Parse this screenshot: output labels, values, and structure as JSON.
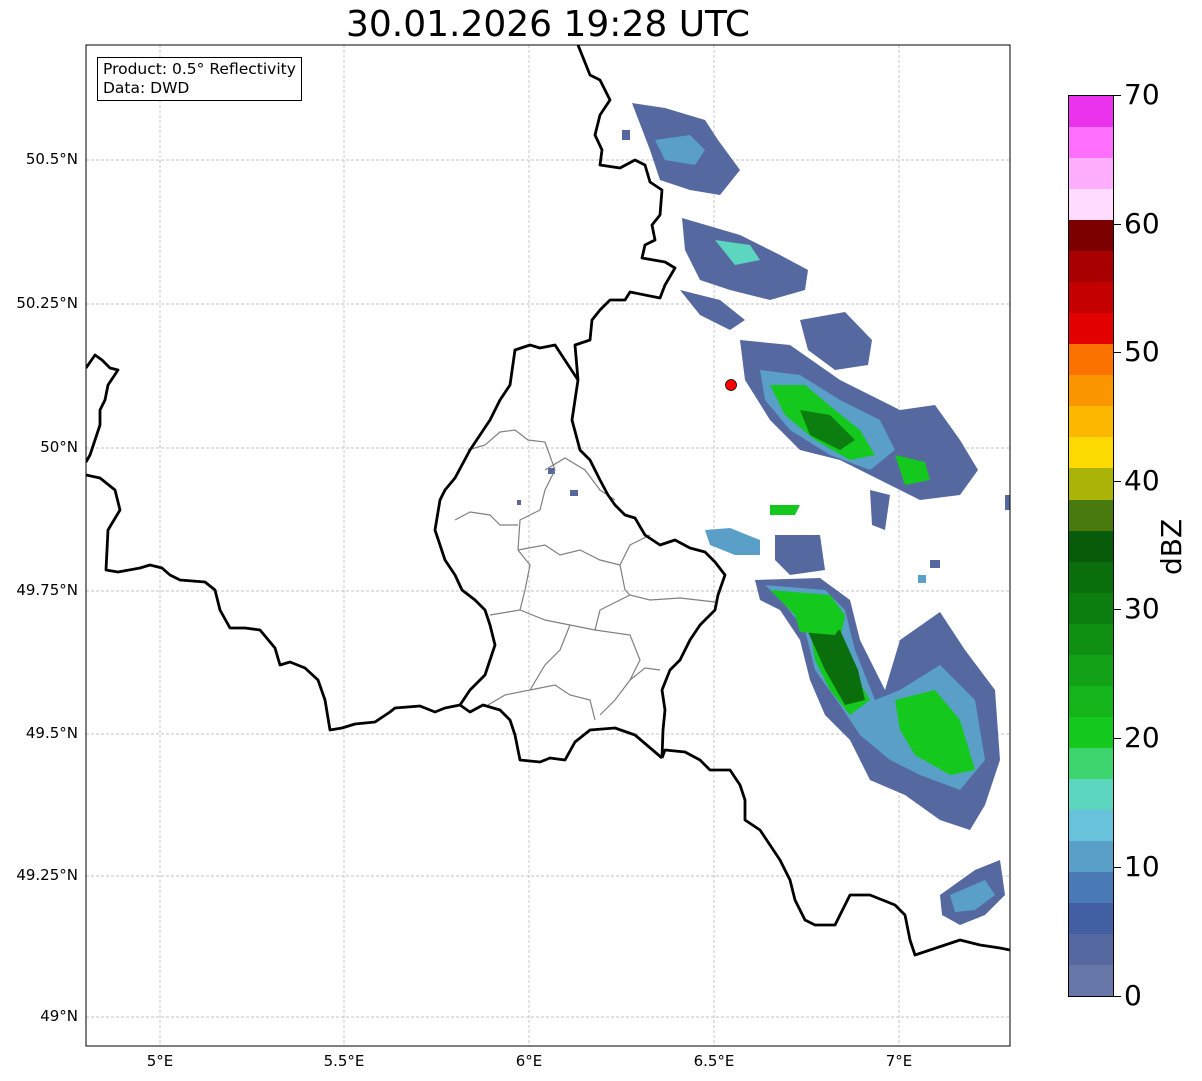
{
  "title": "30.01.2026 19:28 UTC",
  "info": {
    "product": "Product: 0.5° Reflectivity",
    "data": "Data: DWD"
  },
  "lat_ticks": [
    "50.5°N",
    "50.25°N",
    "50°N",
    "49.75°N",
    "49.5°N",
    "49.25°N",
    "49°N"
  ],
  "lon_ticks": [
    "5°E",
    "5.5°E",
    "6°E",
    "6.5°E",
    "7°E"
  ],
  "colorbar": {
    "unit": "dBZ",
    "labels": [
      "0",
      "10",
      "20",
      "30",
      "40",
      "50",
      "60",
      "70"
    ],
    "colors": [
      "#6677a8",
      "#5568a0",
      "#425fa4",
      "#4a7ab6",
      "#5a9fc8",
      "#68c2dc",
      "#5dd6c0",
      "#3cd46c",
      "#15c81d",
      "#14b51a",
      "#12a218",
      "#109012",
      "#0c7e0f",
      "#0a6e0d",
      "#075b09",
      "#497a0d",
      "#aab308",
      "#fcd900",
      "#fcb700",
      "#fc9600",
      "#fc7200",
      "#e20000",
      "#c40000",
      "#a80000",
      "#7c0000",
      "#ffdcff",
      "#ffaefe",
      "#ff70fe",
      "#ea32ec"
    ]
  },
  "marker": {
    "name": "radar-site",
    "color": "#ff0000"
  },
  "colors": {
    "echo_low": "#5568a0",
    "echo_mid": "#5dd6c0",
    "echo_high": "#15c81d",
    "echo_core": "#0a6e0d",
    "border": "#000000",
    "admin": "#808080"
  }
}
